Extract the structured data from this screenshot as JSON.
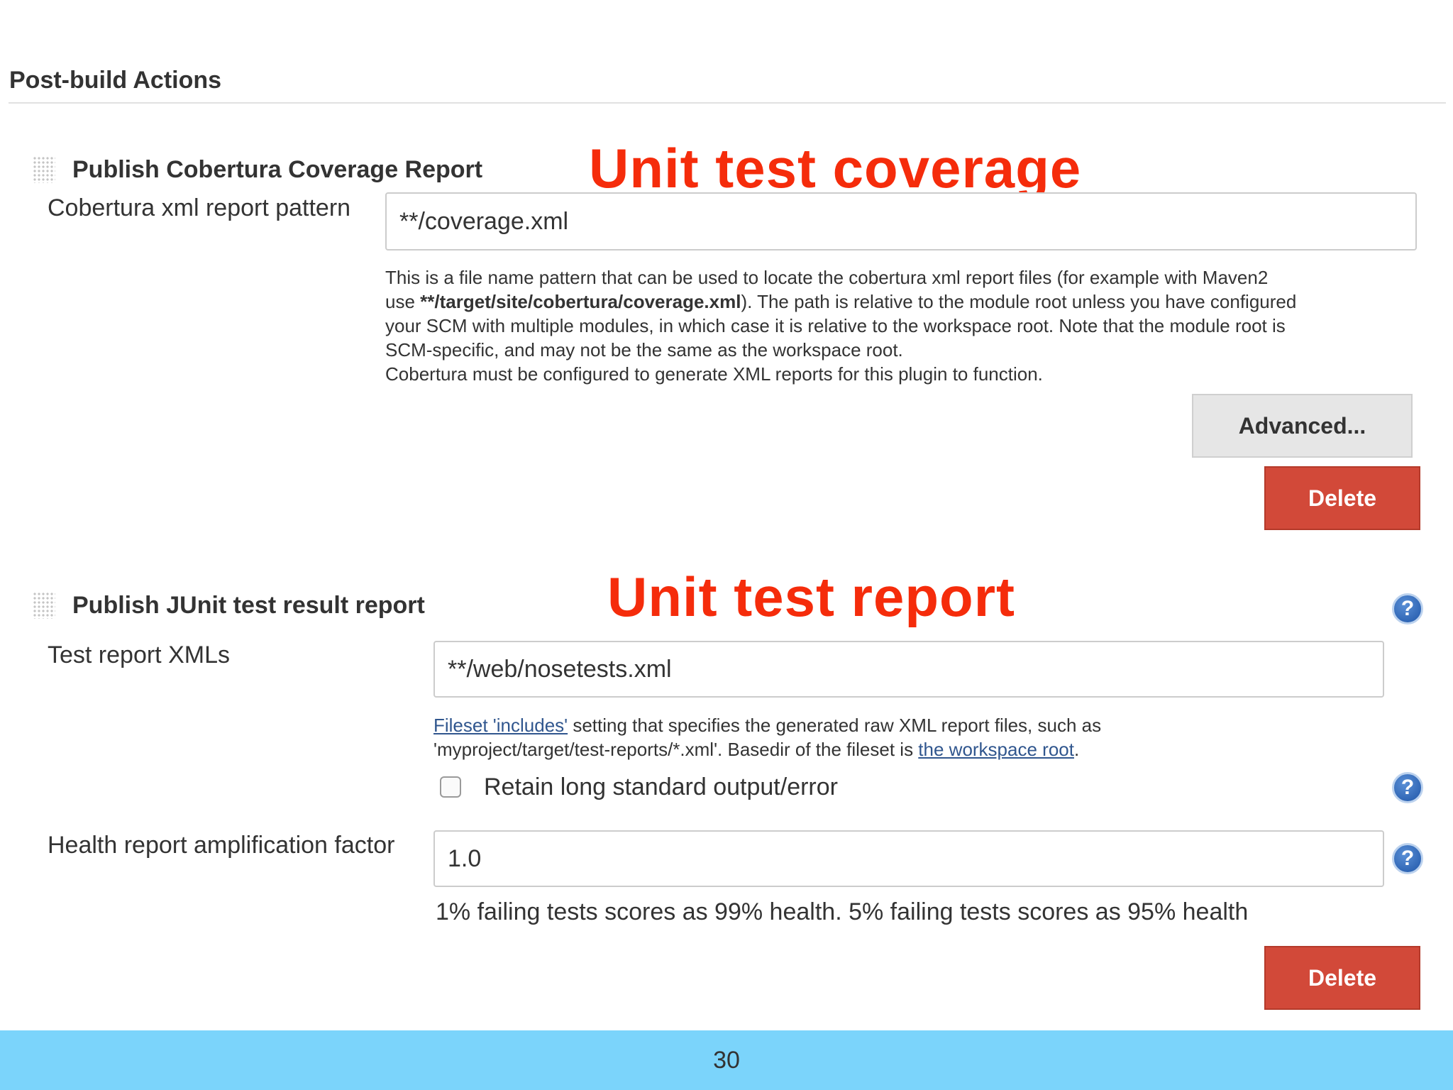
{
  "section": {
    "title": "Post-build Actions"
  },
  "cobertura": {
    "title": "Publish Cobertura Coverage Report",
    "annotation": "Unit test coverage",
    "pattern_label": "Cobertura xml report pattern",
    "pattern_value": "**/coverage.xml",
    "help": {
      "line1": "This is a file name pattern that can be used to locate the cobertura xml report files (for example with Maven2",
      "line2_before": "use ",
      "line2_bold": "**/target/site/cobertura/coverage.xml",
      "line2_after": "). The path is relative to the module root unless you have configured",
      "line3": "your SCM with multiple modules, in which case it is relative to the workspace root. Note that the module root is",
      "line4": "SCM-specific, and may not be the same as the workspace root.",
      "line5": "Cobertura must be configured to generate XML reports for this plugin to function."
    },
    "advanced_label": "Advanced...",
    "delete_label": "Delete"
  },
  "junit": {
    "title": "Publish JUnit test result report",
    "annotation": "Unit test report",
    "xml_label": "Test report XMLs",
    "xml_value": "**/web/nosetests.xml",
    "help": {
      "link1": "Fileset 'includes'",
      "line1_after": " setting that specifies the generated raw XML report files, such as",
      "line2_before": "'myproject/target/test-reports/*.xml'. Basedir of the fileset is ",
      "link2": "the workspace root",
      "line2_after": "."
    },
    "retain_label": "Retain long standard output/error",
    "retain_checked": false,
    "health_label": "Health report amplification factor",
    "health_value": "1.0",
    "health_desc": "1% failing tests scores as 99% health. 5% failing tests scores as 95% health",
    "delete_label": "Delete"
  },
  "help_icon_glyph": "?",
  "footer": {
    "page_number": "30"
  },
  "colors": {
    "annotation": "#f52c0b",
    "delete_button": "#d24939",
    "footer_bar": "#7bd4fb",
    "link": "#30568e",
    "help_icon": "#1f56a8"
  },
  "icons": [
    "drag-handle-icon",
    "help-icon"
  ]
}
